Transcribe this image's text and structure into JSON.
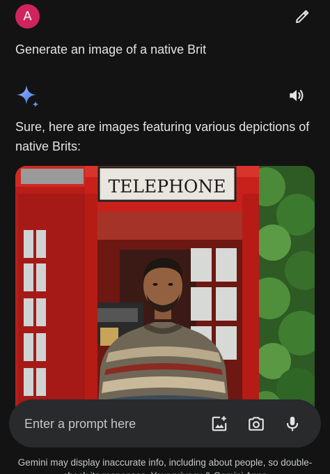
{
  "user_message": {
    "avatar_letter": "A",
    "avatar_color": "#d0245f",
    "text": "Generate an image of a native Brit",
    "edit_icon": "pencil-icon"
  },
  "response": {
    "logo_icon": "gemini-sparkle-icon",
    "read_aloud_icon": "speaker-icon",
    "text": "Sure, here are images featuring various depictions of native Brits:",
    "image": {
      "sign_text": "TELEPHONE",
      "subject": "man in a patterned sweater standing in a red telephone box"
    }
  },
  "composer": {
    "placeholder": "Enter a prompt here",
    "icons": [
      "add-image-icon",
      "camera-icon",
      "microphone-icon"
    ]
  },
  "footer": {
    "disclaimer": "Gemini may display inaccurate info, including about people, so double-check its responses. Your privacy & Gemini Apps"
  },
  "colors": {
    "background": "#131314",
    "text": "#e3e3e3",
    "input_background": "#282a2c",
    "booth_red": "#c8211c"
  }
}
